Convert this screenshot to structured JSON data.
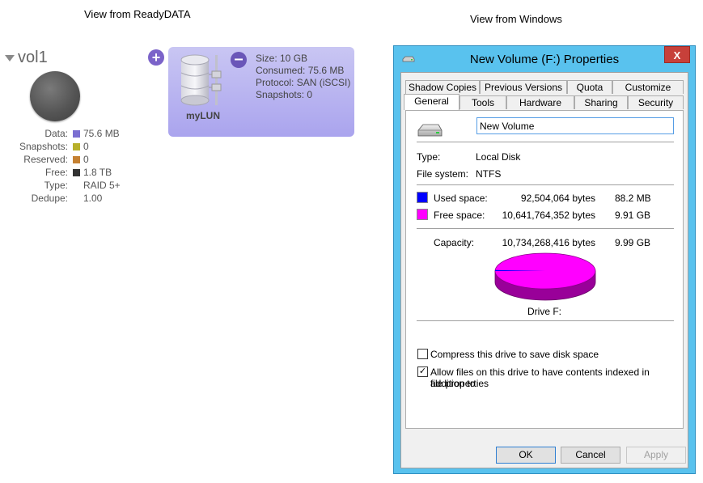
{
  "captions": {
    "left": "View from ReadyDATA",
    "right": "View from Windows"
  },
  "readydata": {
    "volume": {
      "name": "vol1",
      "stats": [
        {
          "label": "Data:",
          "value": "75.6 MB",
          "color": "#7b6fd1"
        },
        {
          "label": "Snapshots:",
          "value": "0",
          "color": "#b8b02a"
        },
        {
          "label": "Reserved:",
          "value": "0",
          "color": "#c58132"
        },
        {
          "label": "Free:",
          "value": "1.8 TB",
          "color": "#333333"
        },
        {
          "label": "Type:",
          "value": "RAID 5+",
          "color": ""
        },
        {
          "label": "Dedupe:",
          "value": "1.00",
          "color": ""
        }
      ]
    },
    "add_icon": "plus-circle-icon",
    "lun": {
      "name": "myLUN",
      "icon": "database-server-icon",
      "remove_icon": "minus-circle-icon",
      "info": [
        "Size: 10 GB",
        "Consumed: 75.6 MB",
        "Protocol: SAN (iSCSI)",
        "Snapshots: 0"
      ],
      "card_color": "#b3aef0"
    }
  },
  "windows": {
    "title": "New Volume (F:) Properties",
    "close_label": "X",
    "tabs_back": [
      "Shadow Copies",
      "Previous Versions",
      "Quota",
      "Customize"
    ],
    "tabs_front": [
      "General",
      "Tools",
      "Hardware",
      "Sharing",
      "Security"
    ],
    "active_tab": "General",
    "volume_name_value": "New Volume",
    "type_label": "Type:",
    "type_value": "Local Disk",
    "fs_label": "File system:",
    "fs_value": "NTFS",
    "used": {
      "label": "Used space:",
      "bytes": "92,504,064 bytes",
      "size": "88.2 MB",
      "color": "#0000ff"
    },
    "free": {
      "label": "Free space:",
      "bytes": "10,641,764,352 bytes",
      "size": "9.91 GB",
      "color": "#ff00ff"
    },
    "capacity": {
      "label": "Capacity:",
      "bytes": "10,734,268,416 bytes",
      "size": "9.99 GB"
    },
    "used_fraction": 0.0086,
    "drive_label": "Drive F:",
    "compress_label": "Compress this drive to save disk space",
    "compress_checked": false,
    "index_label_1": "Allow files on this drive to have contents indexed in addition to",
    "index_label_2": "file properties",
    "index_checked": true,
    "buttons": {
      "ok": "OK",
      "cancel": "Cancel",
      "apply": "Apply"
    },
    "accent": "#59c2ee"
  }
}
